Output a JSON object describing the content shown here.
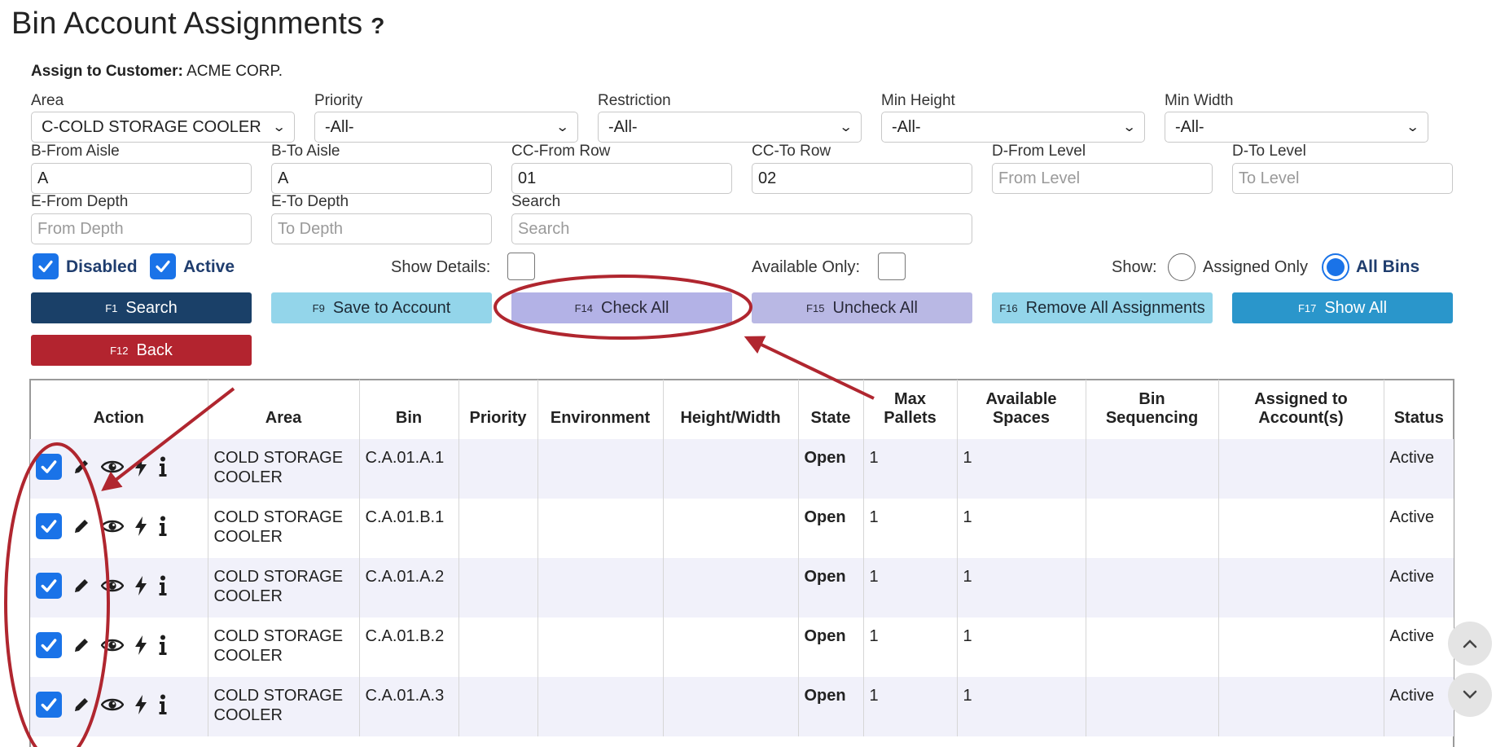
{
  "page": {
    "title": "Bin Account Assignments",
    "help": "?"
  },
  "customer": {
    "label": "Assign to Customer:",
    "value": "ACME CORP."
  },
  "filters": {
    "area": {
      "label": "Area",
      "value": "C-COLD STORAGE COOLER"
    },
    "priority": {
      "label": "Priority",
      "value": "-All-"
    },
    "restriction": {
      "label": "Restriction",
      "value": "-All-"
    },
    "min_height": {
      "label": "Min Height",
      "value": "-All-"
    },
    "min_width": {
      "label": "Min Width",
      "value": "-All-"
    },
    "from_aisle": {
      "label": "B-From Aisle",
      "value": "A"
    },
    "to_aisle": {
      "label": "B-To Aisle",
      "value": "A"
    },
    "from_row": {
      "label": "CC-From Row",
      "value": "01"
    },
    "to_row": {
      "label": "CC-To Row",
      "value": "02"
    },
    "from_level": {
      "label": "D-From Level",
      "placeholder": "From Level"
    },
    "to_level": {
      "label": "D-To Level",
      "placeholder": "To Level"
    },
    "from_depth": {
      "label": "E-From Depth",
      "placeholder": "From Depth"
    },
    "to_depth": {
      "label": "E-To Depth",
      "placeholder": "To Depth"
    },
    "search": {
      "label": "Search",
      "placeholder": "Search"
    }
  },
  "options": {
    "disabled": {
      "label": "Disabled",
      "checked": true
    },
    "active": {
      "label": "Active",
      "checked": true
    },
    "show_details": {
      "label": "Show Details:",
      "checked": false
    },
    "available_only": {
      "label": "Available Only:",
      "checked": false
    },
    "show": {
      "label": "Show:",
      "assigned_only": "Assigned Only",
      "all_bins": "All Bins",
      "selected": "All Bins"
    }
  },
  "buttons": {
    "search": {
      "key": "F1",
      "label": "Search"
    },
    "save": {
      "key": "F9",
      "label": "Save to Account"
    },
    "check_all": {
      "key": "F14",
      "label": "Check All"
    },
    "uncheck_all": {
      "key": "F15",
      "label": "Uncheck All"
    },
    "remove_all": {
      "key": "F16",
      "label": "Remove All Assignments"
    },
    "show_all": {
      "key": "F17",
      "label": "Show All"
    },
    "back": {
      "key": "F12",
      "label": "Back"
    }
  },
  "table": {
    "headers": {
      "action": "Action",
      "area": "Area",
      "bin": "Bin",
      "priority": "Priority",
      "environment": "Environment",
      "height_width": "Height/Width",
      "state": "State",
      "max_pallets_1": "Max",
      "max_pallets_2": "Pallets",
      "available_1": "Available",
      "available_2": "Spaces",
      "sequencing_1": "Bin",
      "sequencing_2": "Sequencing",
      "assigned_1": "Assigned to",
      "assigned_2": "Account(s)",
      "status": "Status"
    },
    "rows": [
      {
        "area_1": "COLD STORAGE",
        "area_2": "COOLER",
        "bin": "C.A.01.A.1",
        "priority": "",
        "environment": "",
        "height_width": "",
        "state": "Open",
        "max_pallets": "1",
        "available": "1",
        "sequencing": "",
        "assigned": "",
        "status": "Active",
        "checked": true
      },
      {
        "area_1": "COLD STORAGE",
        "area_2": "COOLER",
        "bin": "C.A.01.B.1",
        "priority": "",
        "environment": "",
        "height_width": "",
        "state": "Open",
        "max_pallets": "1",
        "available": "1",
        "sequencing": "",
        "assigned": "",
        "status": "Active",
        "checked": true
      },
      {
        "area_1": "COLD STORAGE",
        "area_2": "COOLER",
        "bin": "C.A.01.A.2",
        "priority": "",
        "environment": "",
        "height_width": "",
        "state": "Open",
        "max_pallets": "1",
        "available": "1",
        "sequencing": "",
        "assigned": "",
        "status": "Active",
        "checked": true
      },
      {
        "area_1": "COLD STORAGE",
        "area_2": "COOLER",
        "bin": "C.A.01.B.2",
        "priority": "",
        "environment": "",
        "height_width": "",
        "state": "Open",
        "max_pallets": "1",
        "available": "1",
        "sequencing": "",
        "assigned": "",
        "status": "Active",
        "checked": true
      },
      {
        "area_1": "COLD STORAGE",
        "area_2": "COOLER",
        "bin": "C.A.01.A.3",
        "priority": "",
        "environment": "",
        "height_width": "",
        "state": "Open",
        "max_pallets": "1",
        "available": "1",
        "sequencing": "",
        "assigned": "",
        "status": "Active",
        "checked": true
      }
    ]
  },
  "icons": {
    "help": "question-mark",
    "edit": "pencil-icon",
    "view": "eye-icon",
    "quick": "lightning-icon",
    "info": "info-icon",
    "select_chevron": "chevron-down-icon",
    "scroll_up": "chevron-up-icon",
    "scroll_down": "chevron-down-icon"
  },
  "colors": {
    "checkbox": "#1a73e8",
    "search_btn": "#1a4068",
    "save_btn": "#93d5ea",
    "check_all_btn": "#b3b2e6",
    "show_all_btn": "#2a96cb",
    "back_btn": "#b3242f",
    "annotation": "#b0262f",
    "row_stripe": "#f1f1fa"
  }
}
